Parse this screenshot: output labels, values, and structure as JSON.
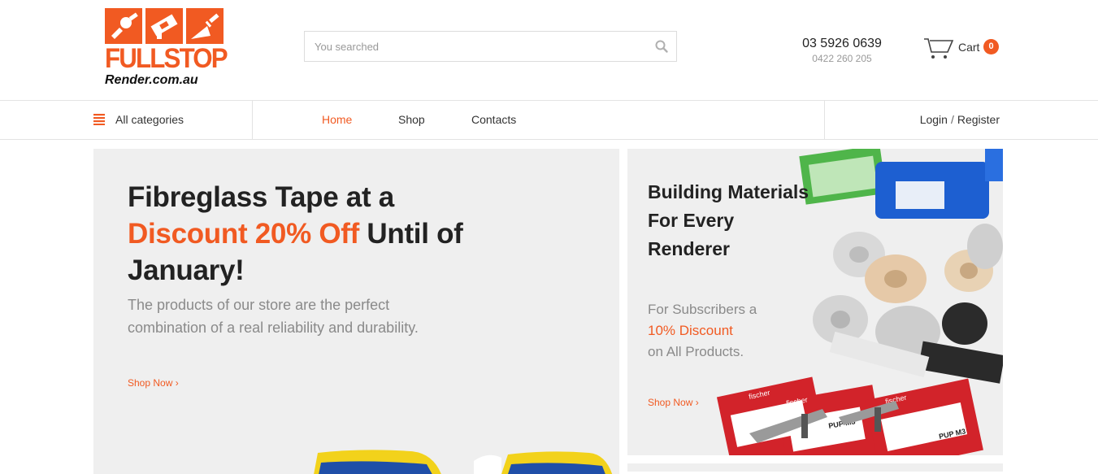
{
  "header": {
    "logo_word": "FULLSTOP",
    "logo_sub": "Render.com.au",
    "search_placeholder": "You searched",
    "phone_main": "03 5926 0639",
    "phone_sub": "0422 260 205",
    "cart_label": "Cart",
    "cart_count": "0"
  },
  "nav": {
    "categories_label": "All categories",
    "links": [
      {
        "label": "Home",
        "active": true
      },
      {
        "label": "Shop",
        "active": false
      },
      {
        "label": "Contacts",
        "active": false
      }
    ],
    "login": "Login",
    "separator": "/",
    "register": "Register"
  },
  "hero": {
    "title_line1": "Fibreglass Tape at a",
    "title_accent": "Discount 20% Off",
    "title_rest": " Until of January!",
    "description": "The products of our store are the perfect combination of a real reliability and durability.",
    "cta": "Shop Now ›"
  },
  "side": {
    "title": "Building Materials For Every Renderer",
    "desc_line1": "For Subscribers a",
    "desc_accent": "10% Discount",
    "desc_line3": "on All Products.",
    "cta": "Shop Now ›",
    "product_label": "fischer",
    "product_model": "PUP M3"
  },
  "colors": {
    "accent": "#f15a22",
    "banner_bg": "#efefef",
    "text_dark": "#222222",
    "text_muted": "#8a8a8a"
  },
  "icons": [
    "trowel-icon",
    "spray-gun-icon",
    "float-icon",
    "search-icon",
    "cart-icon",
    "menu-icon"
  ]
}
